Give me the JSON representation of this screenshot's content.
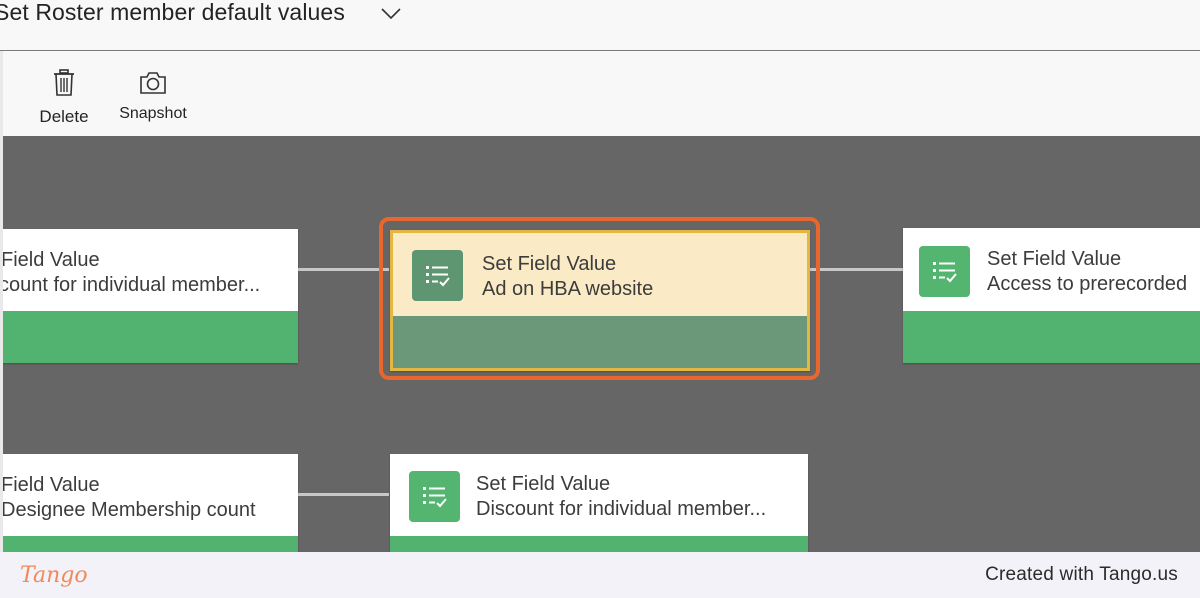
{
  "header": {
    "title": "Set Roster member default values"
  },
  "toolbar": {
    "delete_label": "Delete",
    "snapshot_label": "Snapshot"
  },
  "canvas": {
    "nodes": [
      {
        "title": "Field Value",
        "subtitle": "count for individual member..."
      },
      {
        "title": "Set Field Value",
        "subtitle": "Ad on HBA website"
      },
      {
        "title": "Set Field Value",
        "subtitle": "Access to prerecorded"
      },
      {
        "title": "Field Value",
        "subtitle": "Designee Membership count"
      },
      {
        "title": "Set Field Value",
        "subtitle": "Discount for individual member..."
      }
    ]
  },
  "footer": {
    "brand": "Tango",
    "created_text": "Created with Tango.us"
  },
  "colors": {
    "node_green": "#51b36f",
    "selected_fill": "#faebc6",
    "selected_border": "#e3b743",
    "highlight_ring": "#e8672e",
    "canvas_bg": "#666666"
  }
}
